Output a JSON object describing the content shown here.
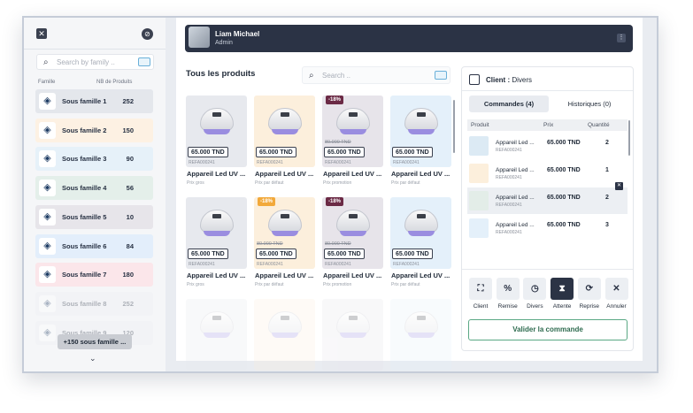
{
  "sidebar": {
    "close_icon": "close-icon",
    "toggle_icon": "disable-icon",
    "search_placeholder": "Search by family ..",
    "col_family": "Famille",
    "col_count": "NB de Produits",
    "families": [
      {
        "name": "Sous famille 1",
        "count": "252",
        "color": "#e4e7ec"
      },
      {
        "name": "Sous famille 2",
        "count": "150",
        "color": "#fdf1e3"
      },
      {
        "name": "Sous famille 3",
        "count": "90",
        "color": "#e6f1f9"
      },
      {
        "name": "Sous famille 4",
        "count": "56",
        "color": "#e4efea"
      },
      {
        "name": "Sous famille 5",
        "count": "10",
        "color": "#e7e5ea"
      },
      {
        "name": "Sous famille 6",
        "count": "84",
        "color": "#e3eefb"
      },
      {
        "name": "Sous famille 7",
        "count": "180",
        "color": "#fbe6ea"
      },
      {
        "name": "Sous famille 8",
        "count": "252",
        "color": "#eef0f3"
      },
      {
        "name": "Sous famille 9",
        "count": "120",
        "color": "#eef0f3"
      }
    ],
    "more_label": "+150 sous famille ..."
  },
  "header": {
    "user_name": "Liam Michael",
    "user_role": "Admin"
  },
  "products": {
    "title": "Tous les produits",
    "search_placeholder": "Search ..",
    "items": [
      {
        "name": "Appareil Led UV ...",
        "ref": "REFA000241",
        "price": "65.000 TND",
        "old": "",
        "discount": "",
        "sub": "Prix gros",
        "bg": "#e7e9ee"
      },
      {
        "name": "Appareil Led UV ...",
        "ref": "REFA000241",
        "price": "65.000 TND",
        "old": "",
        "discount": "",
        "sub": "Prix par défaut",
        "bg": "#fcefdc"
      },
      {
        "name": "Appareil Led UV ...",
        "ref": "REFA000241",
        "price": "65.000 TND",
        "old": "80.000 TND",
        "discount": "-18%",
        "sub": "Prix promotion",
        "bg": "#e7e4ea"
      },
      {
        "name": "Appareil Led UV ...",
        "ref": "REFA000241",
        "price": "65.000 TND",
        "old": "",
        "discount": "",
        "sub": "Prix par défaut",
        "bg": "#e4f0fa"
      },
      {
        "name": "Appareil Led UV ...",
        "ref": "REFA000241",
        "price": "65.000 TND",
        "old": "",
        "discount": "",
        "sub": "Prix gros",
        "bg": "#e7e9ee"
      },
      {
        "name": "Appareil Led UV ...",
        "ref": "REFA000241",
        "price": "65.000 TND",
        "old": "80.000 TND",
        "discount": "-18%",
        "sub": "Prix par défaut",
        "bg": "#fcefdc"
      },
      {
        "name": "Appareil Led UV ...",
        "ref": "REFA000241",
        "price": "65.000 TND",
        "old": "80.000 TND",
        "discount": "-18%",
        "sub": "Prix promotion",
        "bg": "#e7e4ea"
      },
      {
        "name": "Appareil Led UV ...",
        "ref": "REFA000241",
        "price": "65.000 TND",
        "old": "",
        "discount": "",
        "sub": "Prix par défaut",
        "bg": "#e4f0fa"
      }
    ]
  },
  "order": {
    "client_label": "Client :",
    "client_value": "Divers",
    "tab_orders": "Commandes (4)",
    "tab_history": "Historiques (0)",
    "col_product": "Produit",
    "col_price": "Prix",
    "col_qty": "Quantité",
    "lines": [
      {
        "name": "Appareil Led ...",
        "ref": "REFA000241",
        "price": "65.000 TND",
        "qty": "2",
        "bg": "#dceaf4"
      },
      {
        "name": "Appareil Led ...",
        "ref": "REFA000241",
        "price": "65.000 TND",
        "qty": "1",
        "bg": "#fcefdc"
      },
      {
        "name": "Appareil Led ...",
        "ref": "REFA000241",
        "price": "65.000 TND",
        "qty": "2",
        "bg": "#e3ede8"
      },
      {
        "name": "Appareil Led ...",
        "ref": "REFA000241",
        "price": "65.000 TND",
        "qty": "3",
        "bg": "#e4f0fa"
      }
    ],
    "actions": [
      {
        "label": "Client",
        "icon": "⛶"
      },
      {
        "label": "Remise",
        "icon": "%"
      },
      {
        "label": "Divers",
        "icon": "◷"
      },
      {
        "label": "Attente",
        "icon": "⧗"
      },
      {
        "label": "Reprise",
        "icon": "⟳"
      },
      {
        "label": "Annuler",
        "icon": "✕"
      }
    ],
    "validate_label": "Valider la commande"
  }
}
